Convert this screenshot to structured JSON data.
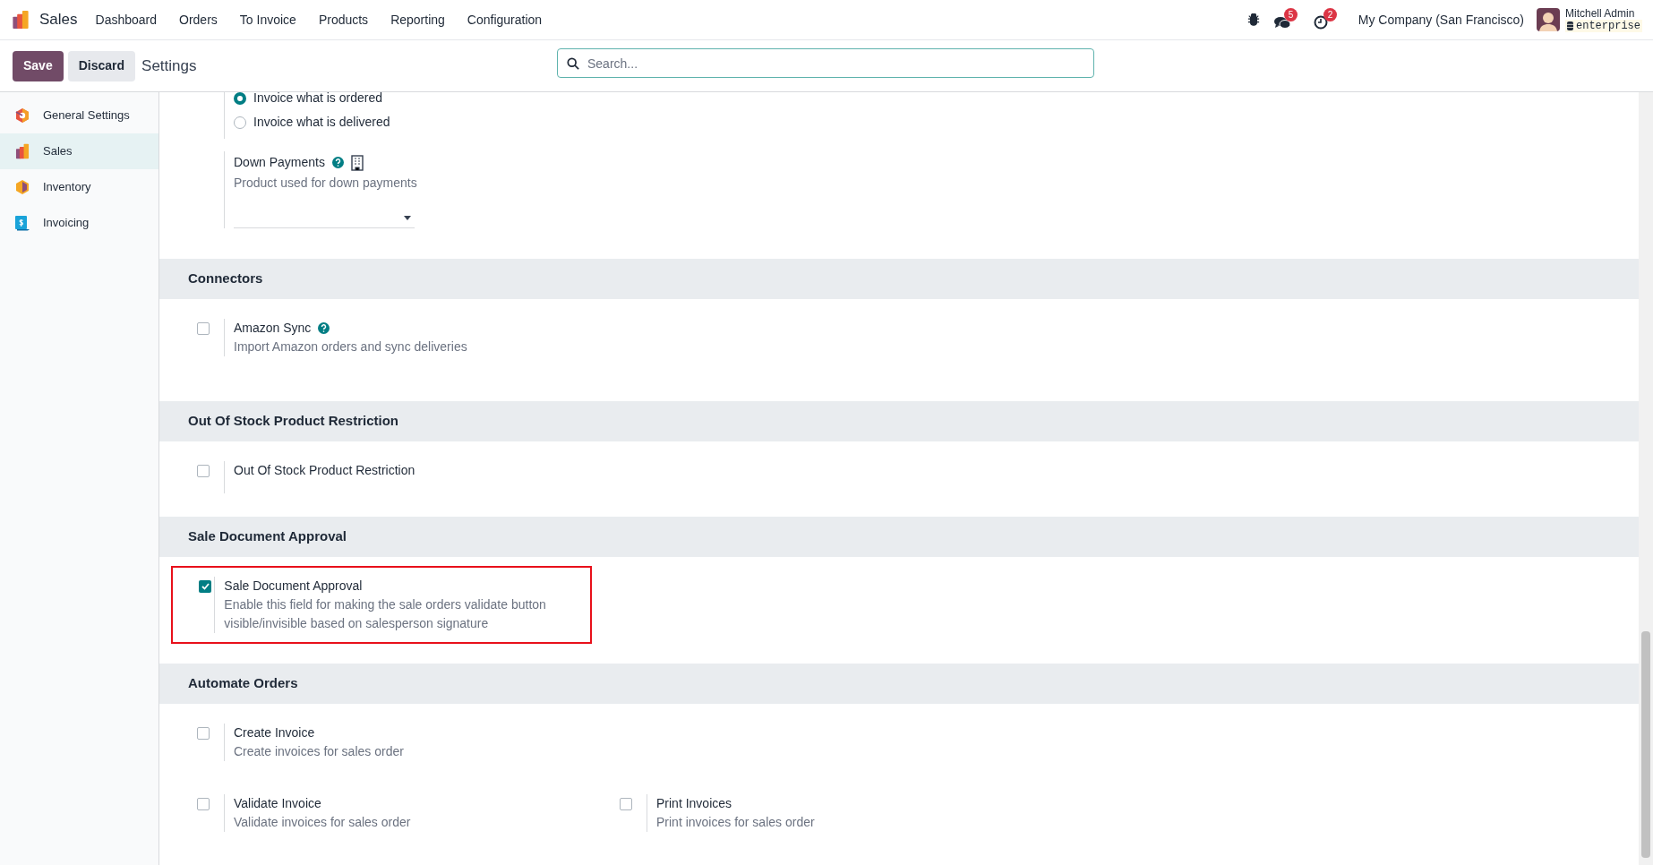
{
  "navbar": {
    "app": "Sales",
    "menu": [
      "Dashboard",
      "Orders",
      "To Invoice",
      "Products",
      "Reporting",
      "Configuration"
    ],
    "counters": [
      {
        "kind": "messages",
        "count": "5"
      },
      {
        "kind": "activities",
        "count": "2"
      }
    ],
    "company": "My Company (San Francisco)",
    "user": "Mitchell Admin",
    "database": "enterprise"
  },
  "control_panel": {
    "buttons": [
      {
        "kind": "primary",
        "label": "Save"
      },
      {
        "kind": "secondary",
        "label": "Discard"
      }
    ],
    "breadcrumb": "Settings",
    "search": {
      "placeholder": "Search..."
    }
  },
  "sidebar": {
    "items": [
      {
        "kind": "general",
        "label": "General Settings",
        "selected": false
      },
      {
        "kind": "sales",
        "label": "Sales",
        "selected": true
      },
      {
        "kind": "inventory",
        "label": "Inventory",
        "selected": false
      },
      {
        "kind": "invoicing",
        "label": "Invoicing",
        "selected": false
      }
    ]
  },
  "invoicing_policy": {
    "options": [
      {
        "label": "Invoice what is ordered",
        "selected": true
      },
      {
        "label": "Invoice what is delivered",
        "selected": false
      }
    ]
  },
  "down_payments": {
    "label": "Down Payments",
    "description": "Product used for down payments"
  },
  "sections": [
    {
      "title": "Connectors",
      "settings": [
        {
          "label": "Amazon Sync",
          "help": true,
          "description": "Import Amazon orders and sync deliveries",
          "checked": false,
          "highlighted": false
        }
      ]
    },
    {
      "title": "Out Of Stock Product Restriction",
      "settings": [
        {
          "label": "Out Of Stock Product Restriction",
          "help": false,
          "checked": false,
          "highlighted": false
        }
      ]
    },
    {
      "title": "Sale Document Approval",
      "settings": [
        {
          "label": "Sale Document Approval",
          "help": false,
          "description": "Enable this field for making the sale orders validate button visible/invisible based on salesperson signature",
          "checked": true,
          "highlighted": true
        }
      ]
    },
    {
      "title": "Automate Orders",
      "settings": [
        {
          "label": "Create Invoice",
          "help": false,
          "description": "Create invoices for sales order",
          "checked": false,
          "highlighted": false,
          "full_row": true
        },
        {
          "label": "Validate Invoice",
          "help": false,
          "description": "Validate invoices for sales order",
          "checked": false,
          "highlighted": false,
          "full_row": false
        },
        {
          "label": "Print Invoices",
          "help": false,
          "description": "Print invoices for sales order",
          "checked": false,
          "highlighted": false,
          "full_row": false
        }
      ]
    }
  ]
}
